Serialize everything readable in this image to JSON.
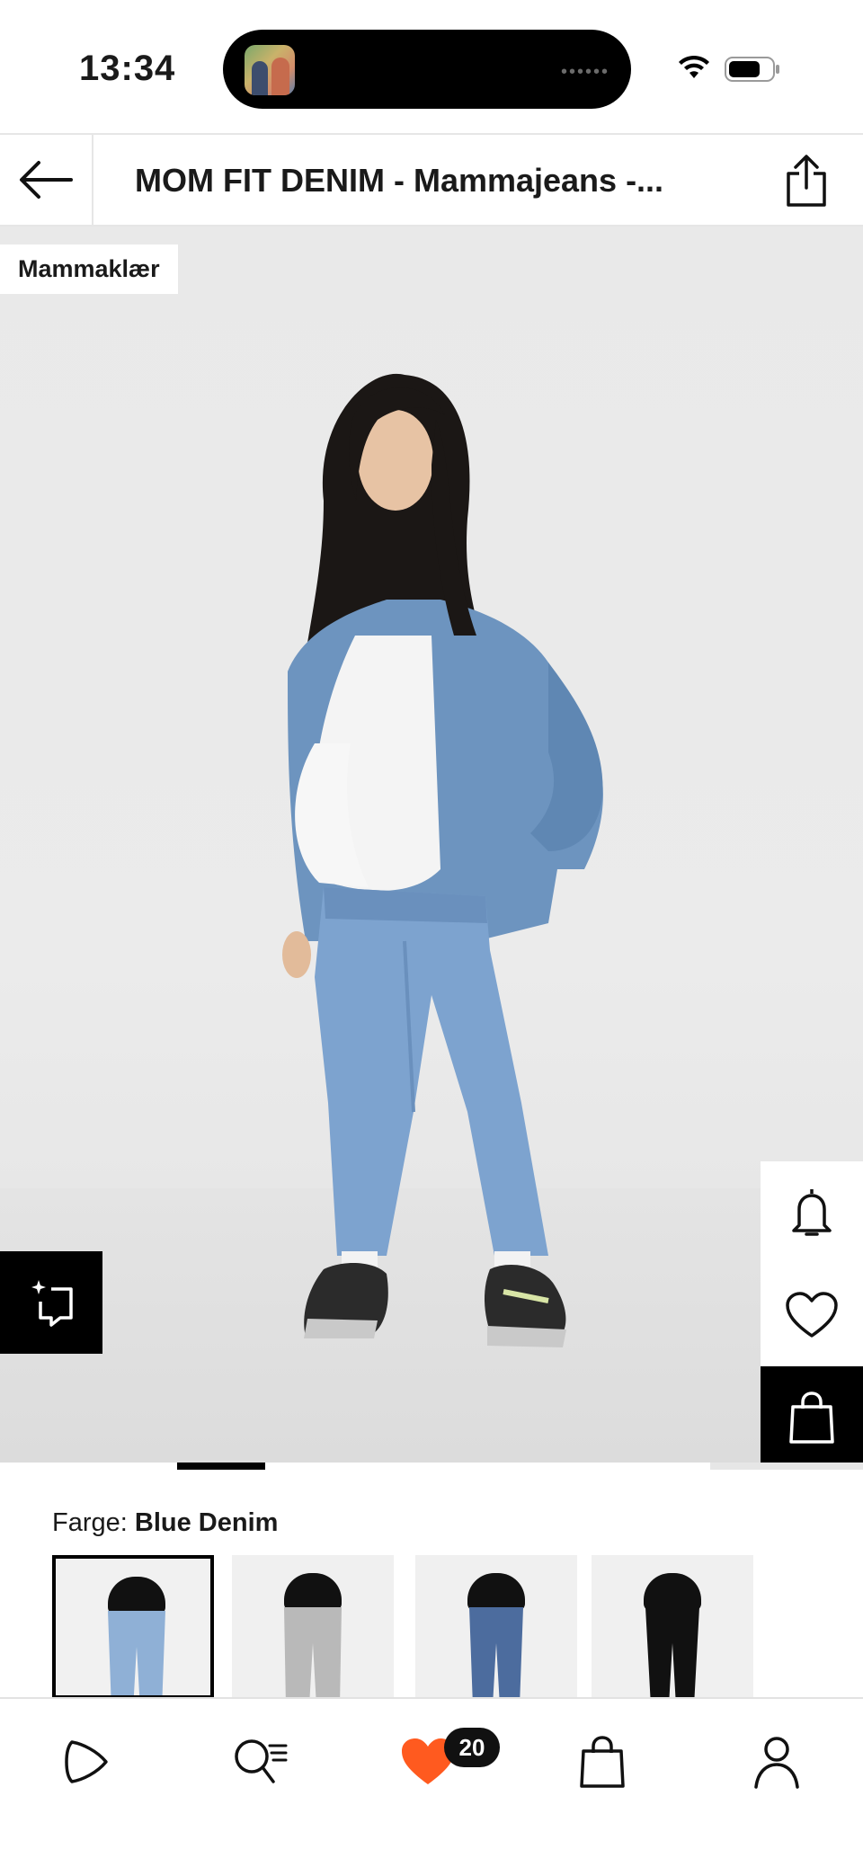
{
  "status_bar": {
    "time": "13:34",
    "wifi_icon": "wifi-icon",
    "battery_icon": "battery-icon"
  },
  "header": {
    "title": "MOM FIT DENIM - Mammajeans -...",
    "back_icon": "arrow-left-icon",
    "share_icon": "share-icon"
  },
  "product_image": {
    "category_badge": "Mammaklær",
    "side_actions": [
      {
        "name": "notify-button",
        "icon": "bell-icon"
      },
      {
        "name": "wishlist-button",
        "icon": "heart-icon"
      },
      {
        "name": "add-to-bag-button",
        "icon": "shopping-bag-icon"
      }
    ],
    "try_on_icon": "sparkle-frame-icon"
  },
  "color": {
    "label": "Farge:",
    "selected": "Blue Denim",
    "swatches": [
      {
        "name": "Blue Denim",
        "color": "#8fb0d6"
      },
      {
        "name": "Grey Denim",
        "color": "#b9b9b9"
      },
      {
        "name": "Dark Denim",
        "color": "#4c6c9e"
      },
      {
        "name": "Black",
        "color": "#111111"
      }
    ]
  },
  "bottom_nav": {
    "items": [
      {
        "name": "nav-play",
        "icon": "play-icon"
      },
      {
        "name": "nav-search",
        "icon": "search-icon"
      },
      {
        "name": "nav-wishlist",
        "icon": "heart-filled-icon"
      },
      {
        "name": "nav-bag",
        "icon": "shopping-bag-icon"
      },
      {
        "name": "nav-profile",
        "icon": "user-icon"
      }
    ],
    "wishlist_count": "20",
    "accent_color": "#ff5a1f"
  }
}
